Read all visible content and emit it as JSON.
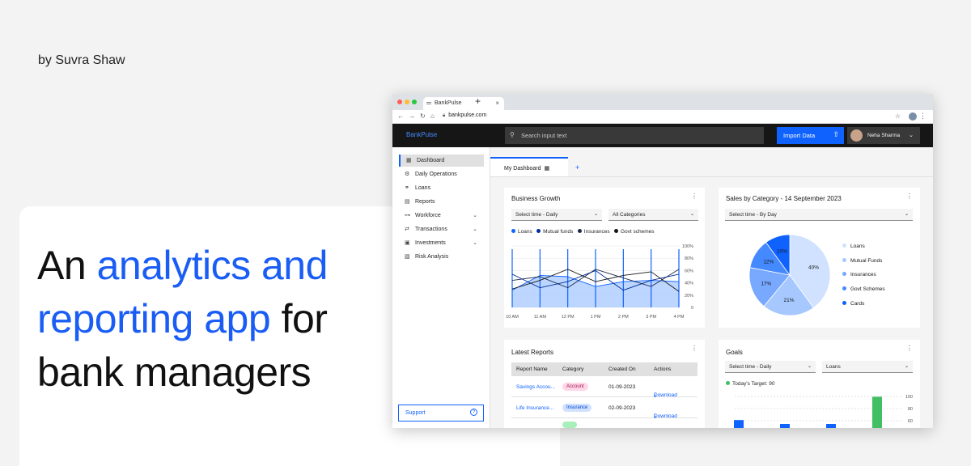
{
  "author": "by Suvra Shaw",
  "hero": {
    "part1": "An",
    "accent": "analytics and reporting app",
    "part2": "for bank managers"
  },
  "browser": {
    "tab_title": "BankPulse",
    "url": "bankpulse.com"
  },
  "appbar": {
    "brand": "BankPulse",
    "search_placeholder": "Search input text",
    "import_label": "Import Data",
    "user_name": "Neha Sharma"
  },
  "sidebar": {
    "items": [
      {
        "label": "Dashboard"
      },
      {
        "label": "Daily Operations"
      },
      {
        "label": "Loans"
      },
      {
        "label": "Reports"
      },
      {
        "label": "Workforce"
      },
      {
        "label": "Transactions"
      },
      {
        "label": "Investments"
      },
      {
        "label": "Risk Analysis"
      }
    ],
    "support_label": "Support"
  },
  "dashboard": {
    "tab_label": "My Dashboard",
    "add_tab": "+"
  },
  "business_growth": {
    "title": "Business Growth",
    "time_select": "Select time - Daily",
    "category_select": "All Categories",
    "legend": [
      "Loans",
      "Mutual funds",
      "Insurances",
      "Govt schemes"
    ],
    "colors": [
      "#0f62fe",
      "#002d9c",
      "#1c2a4a",
      "#161616"
    ]
  },
  "sales_by_category": {
    "title": "Sales by Category - 14 September 2023",
    "time_select": "Select time - By Day",
    "legend": [
      "Loans",
      "Mutual Funds",
      "Insurances",
      "Govt Schemes",
      "Cards"
    ],
    "colors": [
      "#d0e2ff",
      "#a6c8ff",
      "#78a9ff",
      "#4589ff",
      "#0f62fe"
    ]
  },
  "latest_reports": {
    "title": "Latest Reports",
    "columns": [
      "Report Name",
      "Category",
      "Created On",
      "Actions"
    ],
    "rows": [
      {
        "name": "Savings Accou...",
        "category": "Account",
        "date": "01-09-2023",
        "action": "Download"
      },
      {
        "name": "Life Insurance...",
        "category": "Insurance",
        "date": "02-09-2023",
        "action": "Download"
      }
    ]
  },
  "goals": {
    "title": "Goals",
    "time_select": "Select time - Daily",
    "type_select": "Loans",
    "target_label": "Today's Target: 90",
    "colors": [
      "#0f62fe",
      "#42be65"
    ]
  },
  "chart_data": [
    {
      "type": "line",
      "title": "Business Growth",
      "x": [
        "10 AM",
        "11 AM",
        "12 PM",
        "1 PM",
        "2 PM",
        "3 PM",
        "4 PM"
      ],
      "ylim": [
        0,
        100
      ],
      "y_ticks": [
        "100%",
        "80%",
        "60%",
        "40%",
        "20%",
        "0"
      ],
      "series": [
        {
          "name": "Loans",
          "values": [
            28,
            52,
            50,
            34,
            42,
            44,
            42
          ]
        },
        {
          "name": "Mutual funds",
          "values": [
            54,
            32,
            42,
            60,
            28,
            44,
            54
          ]
        },
        {
          "name": "Insurances",
          "values": [
            44,
            50,
            32,
            62,
            48,
            34,
            62
          ]
        },
        {
          "name": "Govt schemes",
          "values": [
            30,
            44,
            62,
            42,
            52,
            58,
            26
          ]
        }
      ]
    },
    {
      "type": "pie",
      "title": "Sales by Category - 14 September 2023",
      "categories": [
        "Loans",
        "Mutual Funds",
        "Insurances",
        "Govt Schemes",
        "Cards"
      ],
      "values": [
        40,
        21,
        17,
        12,
        10
      ],
      "labels": [
        "40%",
        "21%",
        "17%",
        "12%",
        "10%"
      ]
    },
    {
      "type": "bar",
      "title": "Goals",
      "ylim": [
        0,
        100
      ],
      "y_ticks": [
        "100",
        "80",
        "60"
      ],
      "values": [
        64,
        58,
        58,
        96
      ],
      "highlight_last": true
    }
  ]
}
